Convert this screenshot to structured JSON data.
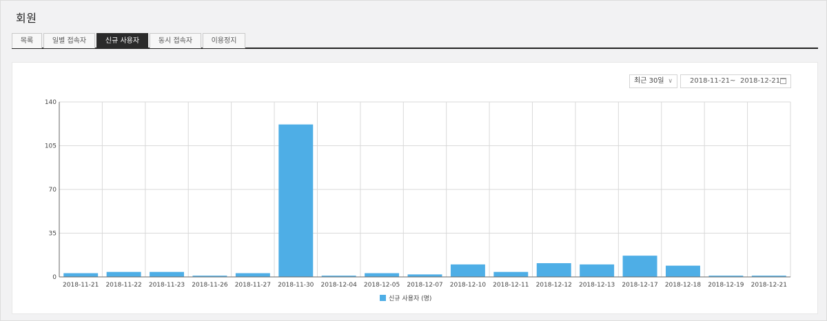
{
  "page": {
    "title": "회원"
  },
  "tabs": [
    {
      "label": "목록",
      "active": false
    },
    {
      "label": "일별 접속자",
      "active": false
    },
    {
      "label": "신규 사용자",
      "active": true
    },
    {
      "label": "동시 접속자",
      "active": false
    },
    {
      "label": "이용정지",
      "active": false
    }
  ],
  "filters": {
    "period_label": "최근 30일",
    "date_from": "2018-11-21",
    "date_separator": "~",
    "date_to": "2018-12-21"
  },
  "colors": {
    "bar": "#4eaee6",
    "active_tab": "#2b2b2b",
    "grid": "#d9d9d9"
  },
  "chart_data": {
    "type": "bar",
    "categories": [
      "2018-11-21",
      "2018-11-22",
      "2018-11-23",
      "2018-11-26",
      "2018-11-27",
      "2018-11-30",
      "2018-12-04",
      "2018-12-05",
      "2018-12-07",
      "2018-12-10",
      "2018-12-11",
      "2018-12-12",
      "2018-12-13",
      "2018-12-17",
      "2018-12-18",
      "2018-12-19",
      "2018-12-21"
    ],
    "series": [
      {
        "name": "신규 사용자 (명)",
        "values": [
          3,
          4,
          4,
          1,
          3,
          122,
          1,
          3,
          2,
          10,
          4,
          11,
          10,
          17,
          9,
          1,
          1
        ]
      }
    ],
    "yticks": [
      "0",
      "35",
      "70",
      "105",
      "140"
    ],
    "ylim": [
      0,
      140
    ],
    "grid": true,
    "legend_position": "bottom-center"
  }
}
